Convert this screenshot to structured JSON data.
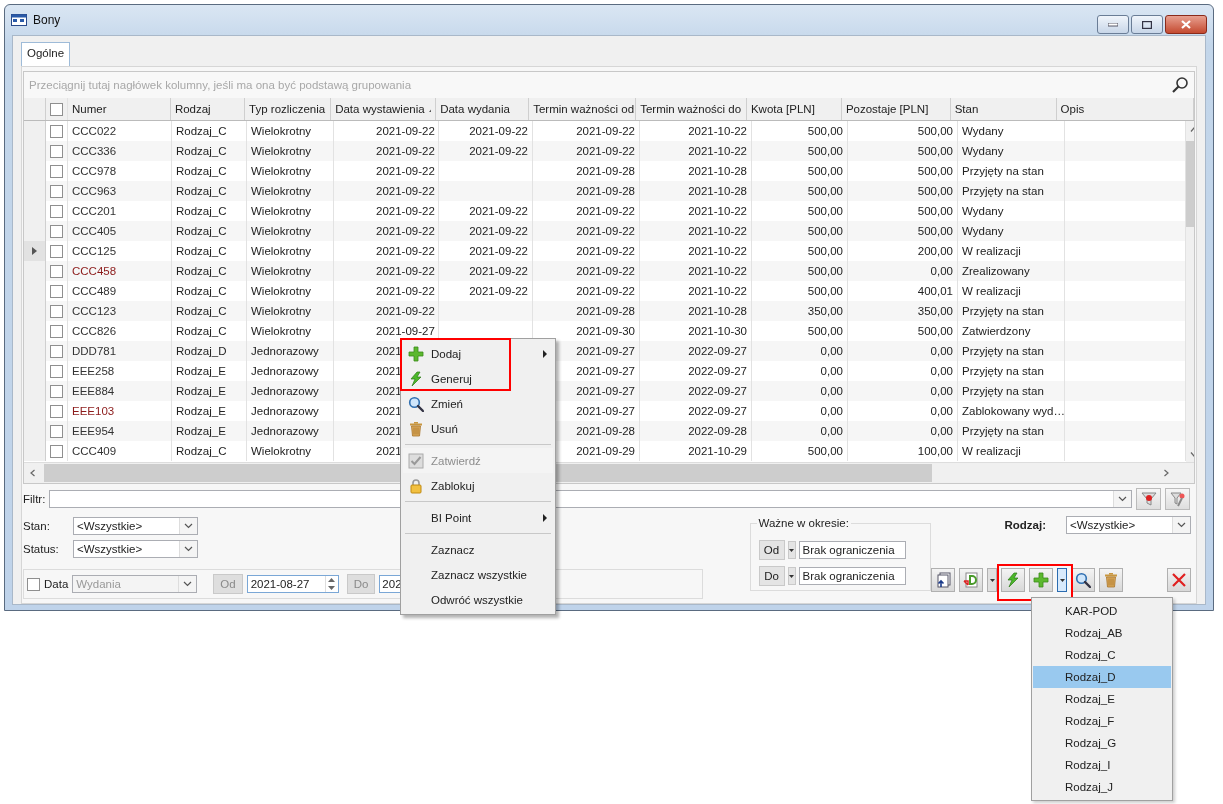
{
  "window": {
    "title": "Bony"
  },
  "tabs": [
    {
      "label": "Ogólne",
      "selected": true
    }
  ],
  "grid": {
    "group_hint": "Przeciągnij tutaj nagłówek kolumny, jeśli ma ona być podstawą grupowania",
    "all_checked": false,
    "columns": [
      {
        "label": "Numer",
        "sorted": false
      },
      {
        "label": "Rodzaj",
        "sorted": false
      },
      {
        "label": "Typ rozliczenia",
        "sorted": false
      },
      {
        "label": "Data wystawienia",
        "sorted": true
      },
      {
        "label": "Data wydania",
        "sorted": false
      },
      {
        "label": "Termin ważności od",
        "sorted": false
      },
      {
        "label": "Termin ważności do",
        "sorted": false
      },
      {
        "label": "Kwota [PLN]",
        "sorted": false
      },
      {
        "label": "Pozostaje [PLN]",
        "sorted": false
      },
      {
        "label": "Stan",
        "sorted": false
      },
      {
        "label": "Opis",
        "sorted": false
      }
    ],
    "rows": [
      {
        "selected": false,
        "checked": false,
        "color": "#333333",
        "numer": "CCC022",
        "rodzaj": "Rodzaj_C",
        "typ": "Wielokrotny",
        "data_wystawienia": "2021-09-22",
        "data_wydania": "2021-09-22",
        "termin_od": "2021-09-22",
        "termin_do": "2021-10-22",
        "kwota": "500,00",
        "pozostaje": "500,00",
        "stan": "Wydany"
      },
      {
        "selected": false,
        "checked": false,
        "color": "#333333",
        "numer": "CCC336",
        "rodzaj": "Rodzaj_C",
        "typ": "Wielokrotny",
        "data_wystawienia": "2021-09-22",
        "data_wydania": "2021-09-22",
        "termin_od": "2021-09-22",
        "termin_do": "2021-10-22",
        "kwota": "500,00",
        "pozostaje": "500,00",
        "stan": "Wydany"
      },
      {
        "selected": false,
        "checked": false,
        "color": "#333333",
        "numer": "CCC978",
        "rodzaj": "Rodzaj_C",
        "typ": "Wielokrotny",
        "data_wystawienia": "2021-09-22",
        "termin_od": "2021-09-28",
        "termin_do": "2021-10-28",
        "kwota": "500,00",
        "pozostaje": "500,00",
        "stan": "Przyjęty na stan"
      },
      {
        "selected": false,
        "checked": false,
        "color": "#333333",
        "numer": "CCC963",
        "rodzaj": "Rodzaj_C",
        "typ": "Wielokrotny",
        "data_wystawienia": "2021-09-22",
        "termin_od": "2021-09-28",
        "termin_do": "2021-10-28",
        "kwota": "500,00",
        "pozostaje": "500,00",
        "stan": "Przyjęty na stan"
      },
      {
        "selected": false,
        "checked": false,
        "color": "#333333",
        "numer": "CCC201",
        "rodzaj": "Rodzaj_C",
        "typ": "Wielokrotny",
        "data_wystawienia": "2021-09-22",
        "data_wydania": "2021-09-22",
        "termin_od": "2021-09-22",
        "termin_do": "2021-10-22",
        "kwota": "500,00",
        "pozostaje": "500,00",
        "stan": "Wydany"
      },
      {
        "selected": false,
        "checked": false,
        "color": "#333333",
        "numer": "CCC405",
        "rodzaj": "Rodzaj_C",
        "typ": "Wielokrotny",
        "data_wystawienia": "2021-09-22",
        "data_wydania": "2021-09-22",
        "termin_od": "2021-09-22",
        "termin_do": "2021-10-22",
        "kwota": "500,00",
        "pozostaje": "500,00",
        "stan": "Wydany"
      },
      {
        "selected": true,
        "checked": false,
        "color": "#333333",
        "numer": "CCC125",
        "rodzaj": "Rodzaj_C",
        "typ": "Wielokrotny",
        "data_wystawienia": "2021-09-22",
        "data_wydania": "2021-09-22",
        "termin_od": "2021-09-22",
        "termin_do": "2021-10-22",
        "kwota": "500,00",
        "pozostaje": "200,00",
        "stan": "W realizacji"
      },
      {
        "selected": false,
        "checked": false,
        "color": "#8b1a1a",
        "numer": "CCC458",
        "rodzaj": "Rodzaj_C",
        "typ": "Wielokrotny",
        "data_wystawienia": "2021-09-22",
        "data_wydania": "2021-09-22",
        "termin_od": "2021-09-22",
        "termin_do": "2021-10-22",
        "kwota": "500,00",
        "pozostaje": "0,00",
        "stan": "Zrealizowany"
      },
      {
        "selected": false,
        "checked": false,
        "color": "#333333",
        "numer": "CCC489",
        "rodzaj": "Rodzaj_C",
        "typ": "Wielokrotny",
        "data_wystawienia": "2021-09-22",
        "data_wydania": "2021-09-22",
        "termin_od": "2021-09-22",
        "termin_do": "2021-10-22",
        "kwota": "500,00",
        "pozostaje": "400,01",
        "stan": "W realizacji"
      },
      {
        "selected": false,
        "checked": false,
        "color": "#333333",
        "numer": "CCC123",
        "rodzaj": "Rodzaj_C",
        "typ": "Wielokrotny",
        "data_wystawienia": "2021-09-22",
        "termin_od": "2021-09-28",
        "termin_do": "2021-10-28",
        "kwota": "350,00",
        "pozostaje": "350,00",
        "stan": "Przyjęty na stan"
      },
      {
        "selected": false,
        "checked": false,
        "color": "#333333",
        "numer": "CCC826",
        "rodzaj": "Rodzaj_C",
        "typ": "Wielokrotny",
        "data_wystawienia": "2021-09-27",
        "termin_od": "2021-09-30",
        "termin_do": "2021-10-30",
        "kwota": "500,00",
        "pozostaje": "500,00",
        "stan": "Zatwierdzony"
      },
      {
        "selected": false,
        "checked": false,
        "color": "#333333",
        "numer": "DDD781",
        "rodzaj": "Rodzaj_D",
        "typ": "Jednorazowy",
        "data_wystawienia": "2021",
        "termin_od": "2021-09-27",
        "termin_do": "2022-09-27",
        "kwota": "0,00",
        "pozostaje": "0,00",
        "stan": "Przyjęty na stan"
      },
      {
        "selected": false,
        "checked": false,
        "color": "#333333",
        "numer": "EEE258",
        "rodzaj": "Rodzaj_E",
        "typ": "Jednorazowy",
        "data_wystawienia": "2021",
        "termin_od": "2021-09-27",
        "termin_do": "2022-09-27",
        "kwota": "0,00",
        "pozostaje": "0,00",
        "stan": "Przyjęty na stan"
      },
      {
        "selected": false,
        "checked": false,
        "color": "#333333",
        "numer": "EEE884",
        "rodzaj": "Rodzaj_E",
        "typ": "Jednorazowy",
        "data_wystawienia": "2021",
        "termin_od": "2021-09-27",
        "termin_do": "2022-09-27",
        "kwota": "0,00",
        "pozostaje": "0,00",
        "stan": "Przyjęty na stan"
      },
      {
        "selected": false,
        "checked": false,
        "color": "#8b1a1a",
        "numer": "EEE103",
        "rodzaj": "Rodzaj_E",
        "typ": "Jednorazowy",
        "data_wystawienia": "2021",
        "termin_od": "2021-09-27",
        "termin_do": "2022-09-27",
        "kwota": "0,00",
        "pozostaje": "0,00",
        "stan": "Zablokowany wyd…"
      },
      {
        "selected": false,
        "checked": false,
        "color": "#333333",
        "numer": "EEE954",
        "rodzaj": "Rodzaj_E",
        "typ": "Jednorazowy",
        "data_wystawienia": "2021",
        "termin_od": "2021-09-28",
        "termin_do": "2022-09-28",
        "kwota": "0,00",
        "pozostaje": "0,00",
        "stan": "Przyjęty na stan"
      },
      {
        "selected": false,
        "checked": false,
        "color": "#333333",
        "numer": "CCC409",
        "rodzaj": "Rodzaj_C",
        "typ": "Wielokrotny",
        "data_wystawienia": "2021",
        "termin_od": "2021-09-29",
        "termin_do": "2021-10-29",
        "kwota": "500,00",
        "pozostaje": "100,00",
        "stan": "W realizacji"
      }
    ]
  },
  "filter": {
    "label": "Filtr:"
  },
  "stan": {
    "label": "Stan:",
    "value": "<Wszystkie>"
  },
  "status": {
    "label": "Status:",
    "value": "<Wszystkie>"
  },
  "date_filter": {
    "label": "Data",
    "checked": false,
    "type": "Wydania",
    "type_disabled": true,
    "from_label": "Od",
    "from": "2021-08-27",
    "to_label": "Do",
    "to": "202"
  },
  "validity": {
    "title": "Ważne w okresie:",
    "from_label": "Od",
    "from": "Brak ograniczenia",
    "to_label": "Do",
    "to": "Brak ograniczenia"
  },
  "rodzaj": {
    "label": "Rodzaj:",
    "value": "<Wszystkie>"
  },
  "context_menu": {
    "items": [
      {
        "kind": "item",
        "label": "Dodaj",
        "disabled": false,
        "submenu": true
      },
      {
        "kind": "item",
        "label": "Generuj",
        "disabled": false,
        "submenu": false
      },
      {
        "kind": "item",
        "label": "Zmień",
        "disabled": false,
        "submenu": false
      },
      {
        "kind": "item",
        "label": "Usuń",
        "disabled": false,
        "submenu": false
      },
      {
        "kind": "separator"
      },
      {
        "kind": "item",
        "label": "Zatwierdź",
        "disabled": true,
        "submenu": false
      },
      {
        "kind": "item",
        "label": "Zablokuj",
        "disabled": false,
        "submenu": false
      },
      {
        "kind": "separator"
      },
      {
        "kind": "item",
        "label": "BI Point",
        "disabled": false,
        "submenu": true
      },
      {
        "kind": "separator"
      },
      {
        "kind": "item",
        "label": "Zaznacz",
        "disabled": false,
        "submenu": false
      },
      {
        "kind": "item",
        "label": "Zaznacz wszystkie",
        "disabled": false,
        "submenu": false
      },
      {
        "kind": "item",
        "label": "Odwróć wszystkie",
        "disabled": false,
        "submenu": false
      }
    ]
  },
  "add_dropdown": {
    "items": [
      {
        "label": "KAR-POD",
        "selected": false
      },
      {
        "label": "Rodzaj_AB",
        "selected": false
      },
      {
        "label": "Rodzaj_C",
        "selected": false
      },
      {
        "label": "Rodzaj_D",
        "selected": true
      },
      {
        "label": "Rodzaj_E",
        "selected": false
      },
      {
        "label": "Rodzaj_F",
        "selected": false
      },
      {
        "label": "Rodzaj_G",
        "selected": false
      },
      {
        "label": "Rodzaj_I",
        "selected": false
      },
      {
        "label": "Rodzaj_J",
        "selected": false
      }
    ]
  }
}
